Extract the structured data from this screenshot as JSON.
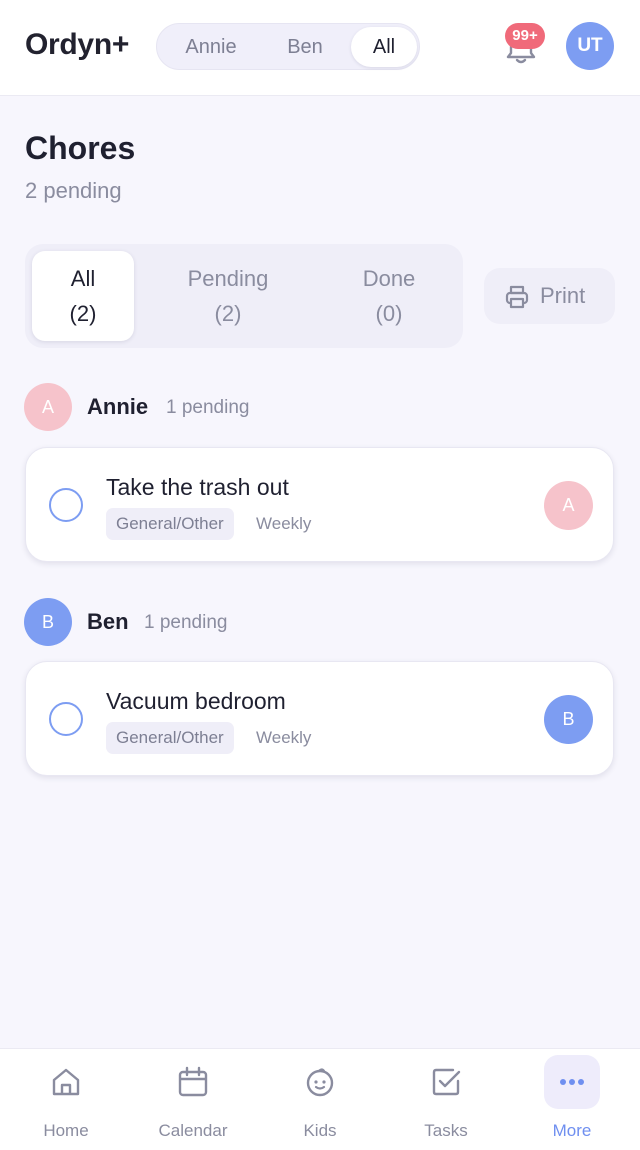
{
  "app": {
    "logo": "Ordyn+"
  },
  "header": {
    "person_switch": [
      "Annie",
      "Ben",
      "All"
    ],
    "selected_person": "All",
    "notification_badge": "99+",
    "user_initials": "UT"
  },
  "page": {
    "title": "Chores",
    "subtitle": "2 pending"
  },
  "filters": {
    "tabs": [
      {
        "label": "All",
        "count": "(2)",
        "active": true
      },
      {
        "label": "Pending",
        "count": "(2)",
        "active": false
      },
      {
        "label": "Done",
        "count": "(0)",
        "active": false
      }
    ],
    "print_label": "Print"
  },
  "groups": [
    {
      "initial": "A",
      "name": "Annie",
      "pending": "1 pending",
      "color": "#f6c3cb",
      "chores": [
        {
          "title": "Take the trash out",
          "category": "General/Other",
          "frequency": "Weekly",
          "assignee_initial": "A"
        }
      ]
    },
    {
      "initial": "B",
      "name": "Ben",
      "pending": "1 pending",
      "color": "#7d9df2",
      "chores": [
        {
          "title": "Vacuum bedroom",
          "category": "General/Other",
          "frequency": "Weekly",
          "assignee_initial": "B"
        }
      ]
    }
  ],
  "colors": {
    "accent": "#7d9df2",
    "badge": "#f06a7a",
    "annie": "#f6c3cb",
    "ben": "#7d9df2"
  },
  "bottom_nav": {
    "items": [
      {
        "label": "Home",
        "icon": "home-icon"
      },
      {
        "label": "Calendar",
        "icon": "calendar-icon"
      },
      {
        "label": "Kids",
        "icon": "kids-icon"
      },
      {
        "label": "Tasks",
        "icon": "tasks-icon"
      },
      {
        "label": "More",
        "icon": "more-icon"
      }
    ],
    "active": "More"
  }
}
